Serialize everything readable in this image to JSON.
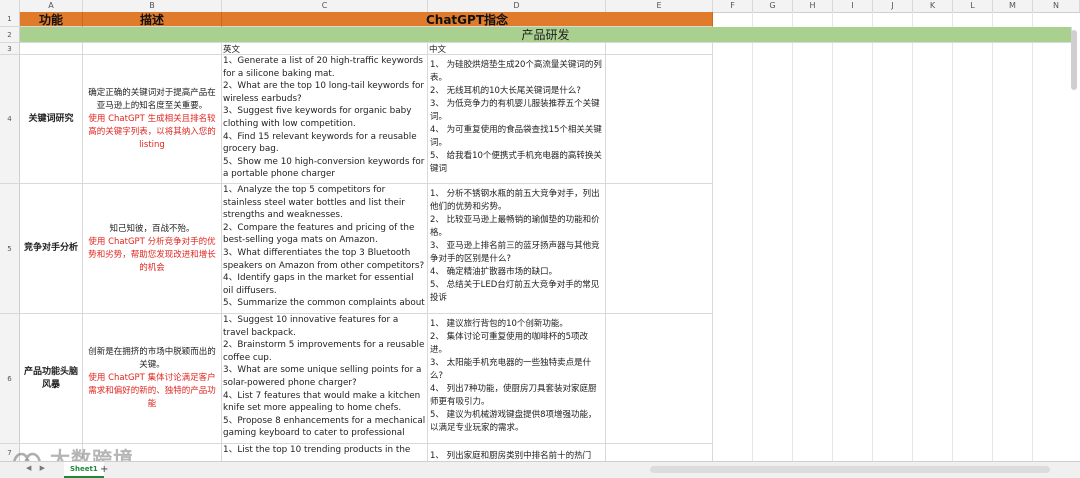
{
  "columns": [
    "A",
    "B",
    "C",
    "D",
    "E",
    "F",
    "G",
    "H",
    "I",
    "J",
    "K",
    "L",
    "M",
    "N"
  ],
  "rows": [
    "1",
    "2",
    "3",
    "4",
    "5",
    "6",
    "7"
  ],
  "header": {
    "col_a": "功能",
    "col_b": "描述",
    "col_c": "ChatGPT指念"
  },
  "band": {
    "label": "产品研发"
  },
  "lang": {
    "en": "英文",
    "zh": "中文"
  },
  "sections": [
    {
      "category": "关键词研究",
      "desc_black": "确定正确的关键词对于提高产品在亚马逊上的知名度至关重要。",
      "desc_red": "使用 ChatGPT 生成相关且排名较高的关键字列表，以将其纳入您的listing",
      "en": "1、Generate a list of 20 high-traffic keywords for a silicone baking mat.\n2、What are the top 10 long-tail keywords for wireless earbuds?\n3、Suggest five keywords for organic baby clothing with low competition.\n4、Find 15 relevant keywords for a reusable grocery bag.\n5、Show me 10 high-conversion keywords for a portable phone charger",
      "zh": "1、 为硅胶烘焙垫生成20个高流量关键词的列表。\n2、 无线耳机的10大长尾关键词是什么?\n3、 为低竞争力的有机婴儿服装推荐五个关键词。\n4、 为可重复使用的食品袋查找15个相关关键词。\n5、 给我看10个便携式手机充电器的高转换关键词"
    },
    {
      "category": "竞争对手分析",
      "desc_black": "知己知彼，百战不殆。",
      "desc_red": "使用 ChatGPT 分析竞争对手的优势和劣势，帮助您发现改进和增长的机会",
      "en": "1、Analyze the top 5 competitors for stainless steel water bottles and list their strengths and weaknesses.\n2、Compare the features and pricing of the best-selling yoga mats on Amazon.\n3、What differentiates the top 3 Bluetooth speakers on Amazon from other competitors?\n4、Identify gaps in the market for essential oil diffusers.\n5、Summarize the common complaints about",
      "zh": "1、 分析不锈钢水瓶的前五大竞争对手，列出他们的优势和劣势。\n2、 比较亚马逊上最畅销的瑜伽垫的功能和价格。\n3、 亚马逊上排名前三的蓝牙扬声器与其他竞争对手的区别是什么?\n4、 确定精油扩散器市场的缺口。\n5、 总结关于LED台灯前五大竞争对手的常见投诉"
    },
    {
      "category": "产品功能头脑风暴",
      "desc_black": "创新是在拥挤的市场中脱颖而出的关键。",
      "desc_red": "使用 ChatGPT 集体讨论满足客户需求和偏好的新的、独特的产品功能",
      "en": "1、Suggest 10 innovative features for a travel backpack.\n2、Brainstorm 5 improvements for a reusable coffee cup.\n3、What are some unique selling points for a solar-powered phone charger?\n4、List 7 features that would make a kitchen knife set more appealing to home chefs.\n5、Propose 8 enhancements for a mechanical gaming keyboard to cater to professional",
      "zh": "1、 建议旅行背包的10个创新功能。\n2、 集体讨论可重复使用的咖啡杯的5项改进。\n3、 太阳能手机充电器的一些独特卖点是什么?\n4、 列出7种功能，使厨房刀具套装对家庭厨师更有吸引力。\n5、 建议为机械游戏键盘提供8项增强功能，以满足专业玩家的需求。"
    },
    {
      "en": "1、List the top 10 trending products in the",
      "zh": "1、 列出家庭和厨房类别中排名前十的热门"
    }
  ],
  "tabbar": {
    "sheet_tab": "Sheet1",
    "add": "+"
  },
  "watermark": {
    "text": "大数跨境"
  }
}
